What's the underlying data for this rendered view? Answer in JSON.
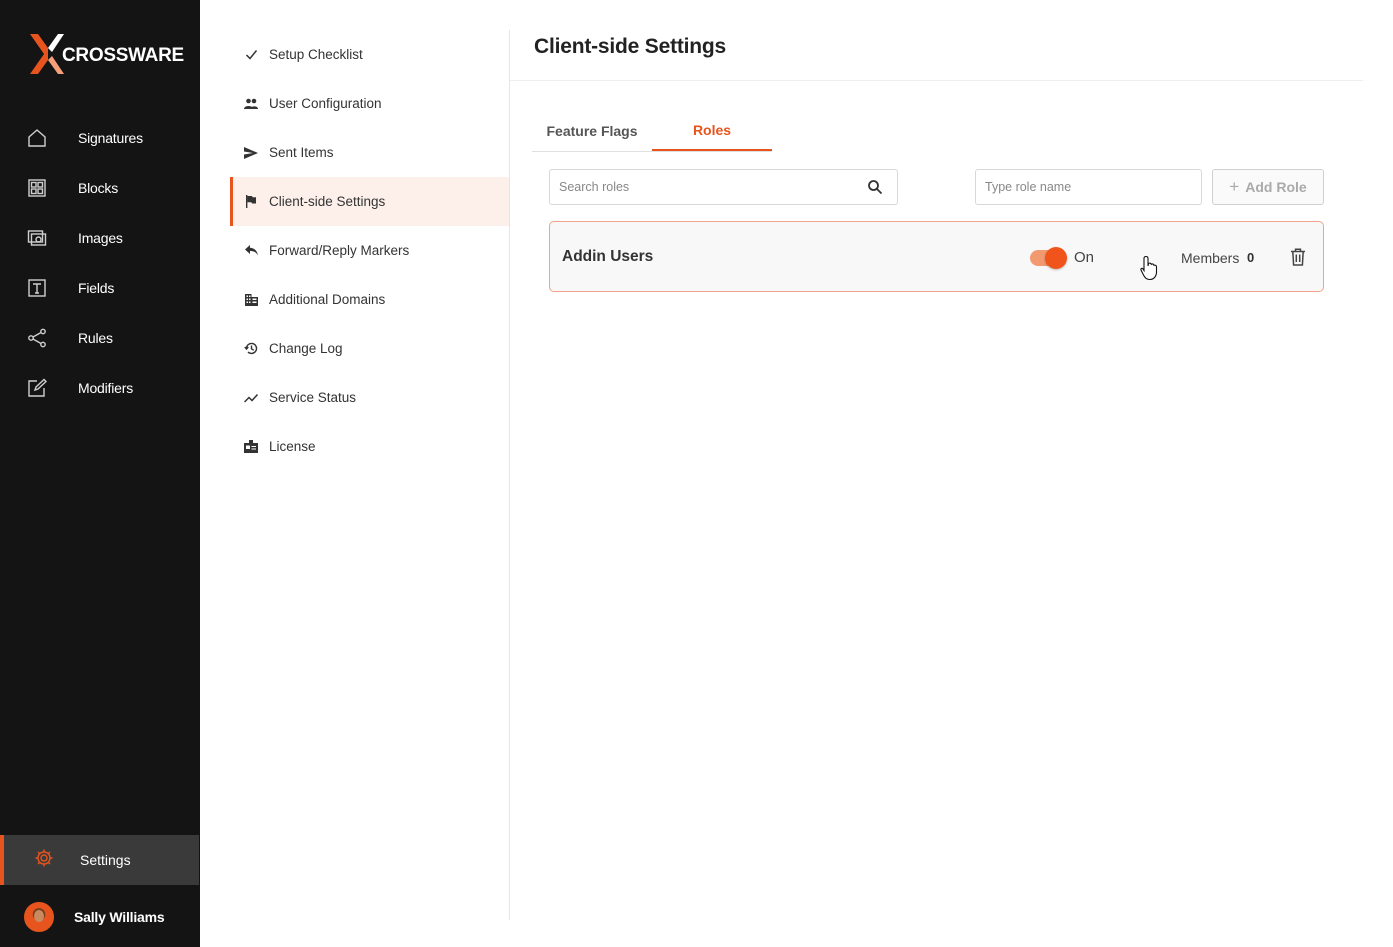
{
  "brand": {
    "name": "CROSSWARE",
    "accent": "#e8541d"
  },
  "sidebar": {
    "items": [
      {
        "label": "Signatures",
        "icon": "house-icon"
      },
      {
        "label": "Blocks",
        "icon": "blocks-icon"
      },
      {
        "label": "Images",
        "icon": "images-icon"
      },
      {
        "label": "Fields",
        "icon": "text-field-icon"
      },
      {
        "label": "Rules",
        "icon": "share-nodes-icon"
      },
      {
        "label": "Modifiers",
        "icon": "edit-square-icon"
      }
    ],
    "settings_label": "Settings",
    "user_name": "Sally Williams"
  },
  "submenu": {
    "items": [
      {
        "label": "Setup Checklist",
        "icon": "check-icon"
      },
      {
        "label": "User Configuration",
        "icon": "people-icon"
      },
      {
        "label": "Sent Items",
        "icon": "send-icon"
      },
      {
        "label": "Client-side Settings",
        "icon": "flag-icon",
        "active": true
      },
      {
        "label": "Forward/Reply Markers",
        "icon": "reply-icon"
      },
      {
        "label": "Additional Domains",
        "icon": "building-icon"
      },
      {
        "label": "Change Log",
        "icon": "history-icon"
      },
      {
        "label": "Service Status",
        "icon": "trend-icon"
      },
      {
        "label": "License",
        "icon": "badge-icon"
      }
    ]
  },
  "main": {
    "title": "Client-side Settings",
    "tabs": [
      {
        "label": "Feature Flags",
        "active": false
      },
      {
        "label": "Roles",
        "active": true
      }
    ],
    "search": {
      "placeholder": "Search roles",
      "value": ""
    },
    "new_role": {
      "placeholder": "Type role name",
      "value": ""
    },
    "add_role_label": "Add Role",
    "roles": [
      {
        "name": "Addin Users",
        "enabled": true,
        "state_label": "On",
        "members_label": "Members",
        "members_count": "0"
      }
    ]
  }
}
